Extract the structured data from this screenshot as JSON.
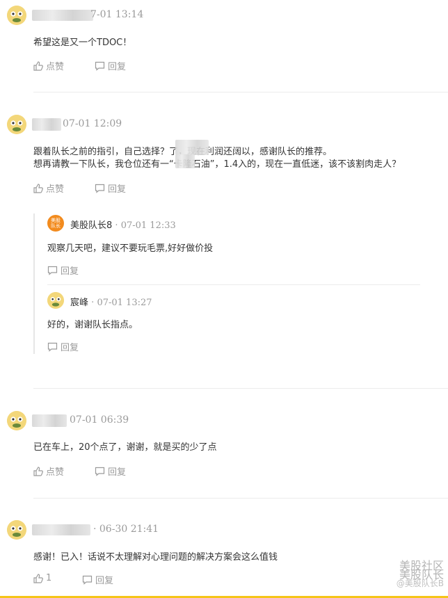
{
  "comments": [
    {
      "time": "7-01 13:14",
      "text": "希望这是又一个TDOC！",
      "like_label": "点赞",
      "reply_label": "回复"
    },
    {
      "time": "07-01 12:09",
      "text_line1": "跟着队长之前的指引，自己选择？了，现在利润还阔以，感谢队长的推荐。",
      "text_line2": "想再请教一下队长，我仓位还有一“卡隆石油”，1.4入的，现在一直低迷，该不该割肉走人？",
      "like_label": "点赞",
      "reply_label": "回复",
      "replies": [
        {
          "logo_text": "美股队长",
          "name": "美股队长8",
          "sep": "·",
          "time": "07-01 12:33",
          "text": "观察几天吧，建议不要玩毛票,好好做价投",
          "reply_label": "回复"
        },
        {
          "name": "宸峰",
          "sep": "·",
          "time": "07-01 13:27",
          "text": "好的，谢谢队长指点。",
          "reply_label": "回复"
        }
      ]
    },
    {
      "time": "07-01 06:39",
      "text": "已在车上，20个点了，谢谢，就是买的少了点",
      "like_label": "点赞",
      "reply_label": "回复"
    },
    {
      "time": "· 06-30 21:41",
      "text": "感谢！已入！话说不太理解对心理问题的解决方案会这么值钱",
      "like_count": "1",
      "reply_label": "回复"
    }
  ],
  "watermark": {
    "line1": "美股社区",
    "line2": "美股队长",
    "line3": "@美股队长B"
  },
  "colors": {
    "accent": "#f5c518",
    "muted": "#9a9a9a",
    "text": "#333333"
  }
}
